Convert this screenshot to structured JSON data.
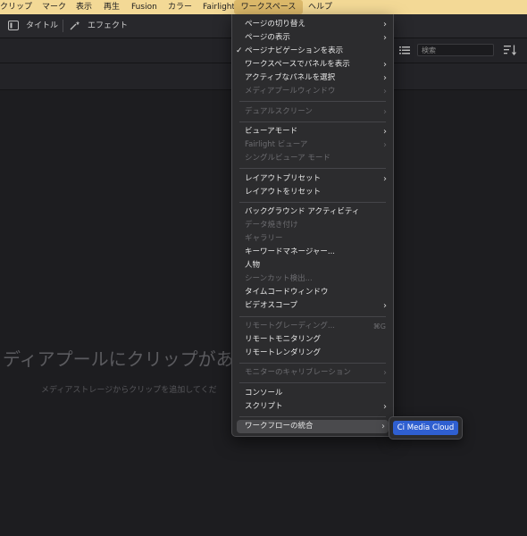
{
  "menubar": {
    "items": [
      "クリップ",
      "マーク",
      "表示",
      "再生",
      "Fusion",
      "カラー",
      "Fairlight",
      "ワークスペース",
      "ヘルプ"
    ]
  },
  "toolbar": {
    "title_label": "タイトル",
    "effects_label": "エフェクト"
  },
  "search": {
    "placeholder": "検索"
  },
  "empty_state": {
    "title": "ディアプールにクリップがあり",
    "subtitle": "メディアストレージからクリップを追加してくだ"
  },
  "workspace_menu": {
    "items": [
      {
        "label": "ページの切り替え"
      },
      {
        "label": "ページの表示"
      },
      {
        "label": "ページナビゲーションを表示",
        "check": "✓"
      },
      {
        "label": "ワークスペースでパネルを表示"
      },
      {
        "label": "アクティブなパネルを選択"
      },
      {
        "label": "メディアプールウィンドウ"
      },
      {
        "label": "デュアルスクリーン"
      },
      {
        "label": "ビューアモード"
      },
      {
        "label": "Fairlight ビューア"
      },
      {
        "label": "シングルビューア モード"
      },
      {
        "label": "レイアウトプリセット"
      },
      {
        "label": "レイアウトをリセット"
      },
      {
        "label": "バックグラウンド アクティビティ"
      },
      {
        "label": "データ焼き付け"
      },
      {
        "label": "ギャラリー"
      },
      {
        "label": "キーワードマネージャー..."
      },
      {
        "label": "人物"
      },
      {
        "label": "シーンカット検出..."
      },
      {
        "label": "タイムコードウィンドウ"
      },
      {
        "label": "ビデオスコープ"
      },
      {
        "label": "リモートグレーディング...",
        "shortcut": "⌘G"
      },
      {
        "label": "リモートモニタリング"
      },
      {
        "label": "リモートレンダリング"
      },
      {
        "label": "モニターのキャリブレーション"
      },
      {
        "label": "コンソール"
      },
      {
        "label": "スクリプト"
      },
      {
        "label": "ワークフローの統合"
      }
    ]
  },
  "submenu": {
    "item": "Ci Media Cloud"
  },
  "colors": {
    "menubar": "#f3d996",
    "menu_bg": "#2c2c2e",
    "highlight": "#4a4a4d",
    "accent": "#2f5fd0"
  }
}
